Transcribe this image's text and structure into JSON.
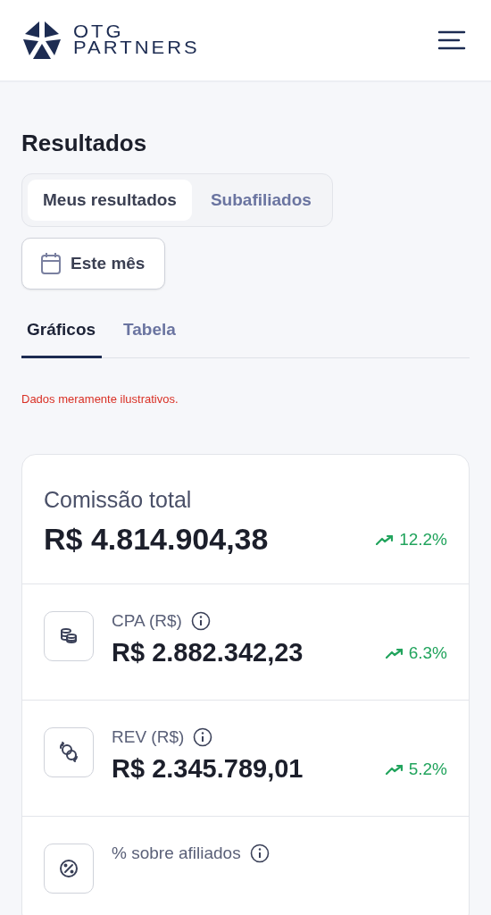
{
  "header": {
    "logo_lines": [
      "OTG",
      "PARTNERS"
    ]
  },
  "title": "Resultados",
  "segments": [
    {
      "label": "Meus resultados",
      "selected": true
    },
    {
      "label": "Subafiliados",
      "selected": false
    }
  ],
  "date_filter": {
    "label": "Este mês"
  },
  "tabs": [
    {
      "label": "Gráficos",
      "selected": true
    },
    {
      "label": "Tabela",
      "selected": false
    }
  ],
  "disclaimer": "Dados meramente ilustrativos.",
  "total": {
    "label": "Comissão total",
    "value": "R$ 4.814.904,38",
    "change": "12.2%"
  },
  "metrics": [
    {
      "kind": "coins",
      "label": "CPA (R$)",
      "value": "R$ 2.882.342,23",
      "change": "6.3%"
    },
    {
      "kind": "exchange",
      "label": "REV (R$)",
      "value": "R$ 2.345.789,01",
      "change": "5.2%"
    },
    {
      "kind": "percent",
      "label": "% sobre afiliados"
    }
  ]
}
